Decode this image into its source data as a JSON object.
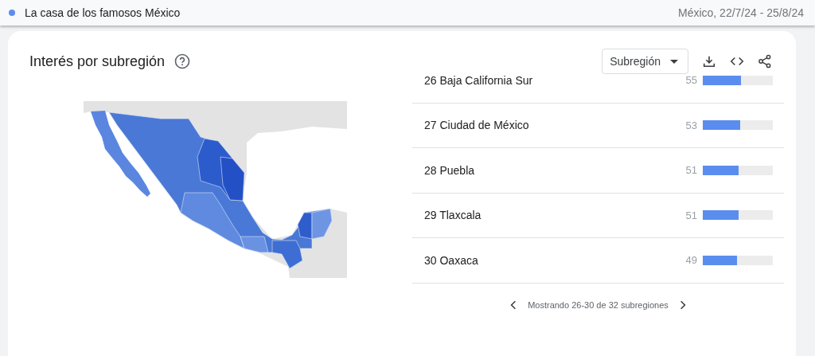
{
  "top_bar": {
    "term": {
      "label": "La casa de los famosos México",
      "color": "#5e8df0"
    },
    "scope": "México, 22/7/24 - 25/8/24"
  },
  "card": {
    "title": "Interés por subregión",
    "dropdown": {
      "value": "Subregión"
    },
    "rows": [
      {
        "label": "26 Baja California Sur",
        "value": "55",
        "level": 0.55
      },
      {
        "label": "27 Ciudad de México",
        "value": "53",
        "level": 0.53
      },
      {
        "label": "28 Puebla",
        "value": "51",
        "level": 0.51
      },
      {
        "label": "29 Tlaxcala",
        "value": "51",
        "level": 0.51
      },
      {
        "label": "30 Oaxaca",
        "value": "49",
        "level": 0.49
      }
    ],
    "pagination": "Mostrando 26-30 de 32 subregiones"
  }
}
